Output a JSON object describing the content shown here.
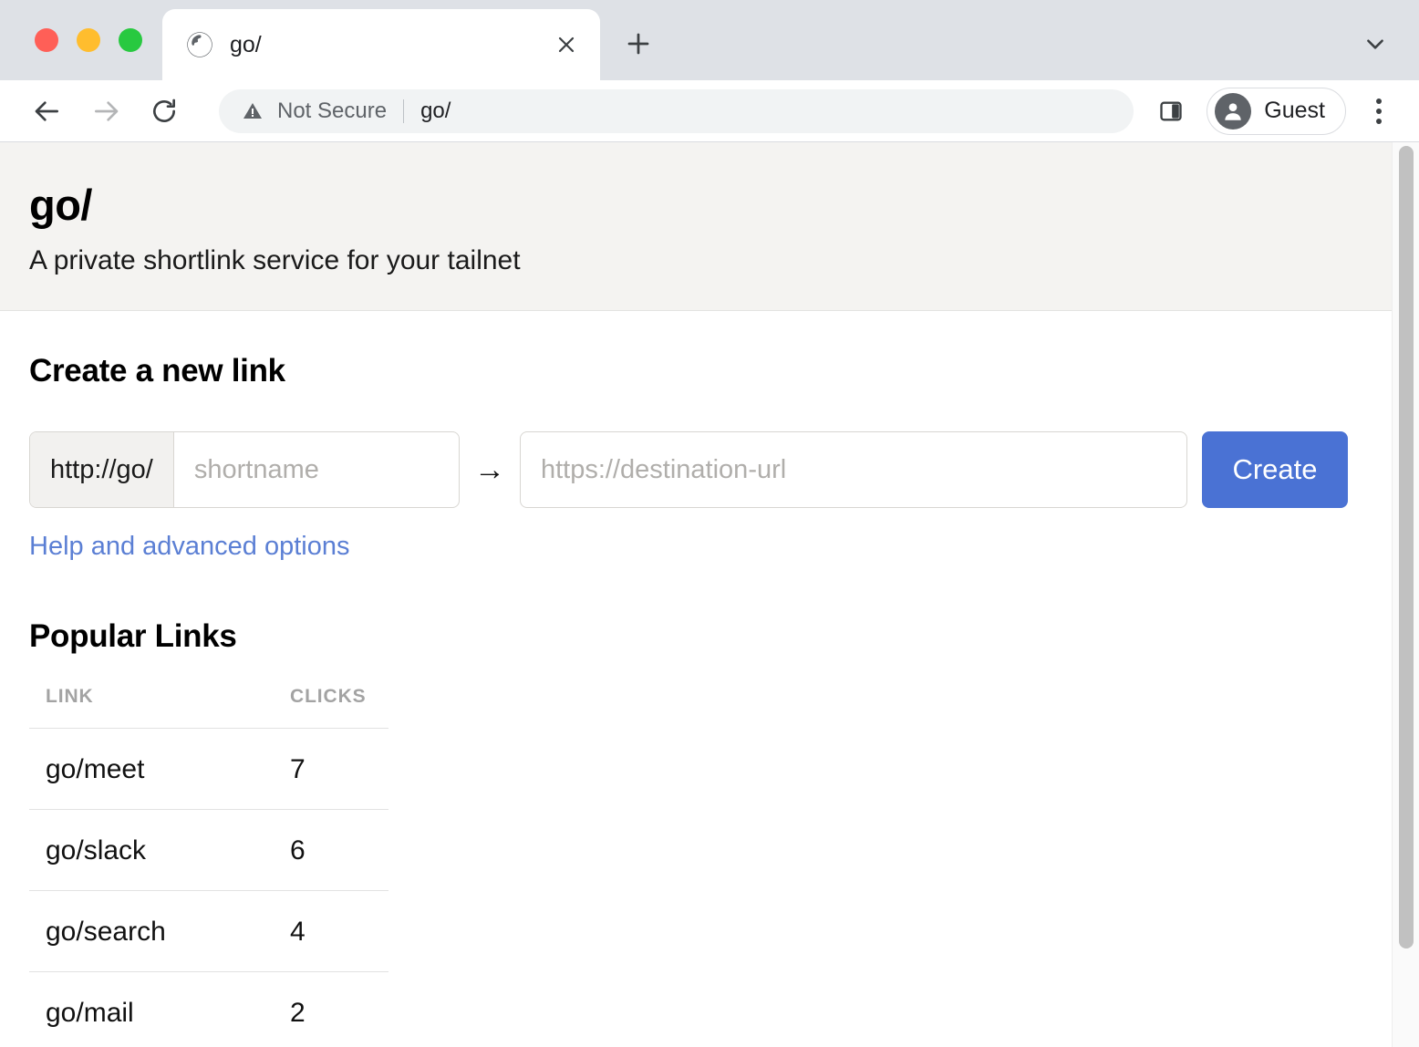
{
  "browser": {
    "window_controls": [
      "close",
      "minimize",
      "zoom"
    ],
    "tab": {
      "title": "go/",
      "favicon": "globe-icon",
      "close_label": "×"
    },
    "new_tab_label": "+",
    "tab_search_icon": "chevron-down-icon",
    "toolbar": {
      "back_icon": "back-arrow-icon",
      "forward_icon": "forward-arrow-icon",
      "reload_icon": "reload-icon",
      "security_icon": "warning-triangle-icon",
      "security_text": "Not Secure",
      "url": "go/",
      "side_panel_icon": "side-panel-icon",
      "profile_name": "Guest",
      "profile_icon": "account-avatar-icon",
      "menu_icon": "kebab-menu-icon"
    }
  },
  "site": {
    "title": "go/",
    "tagline": "A private shortlink service for your tailnet"
  },
  "create": {
    "heading": "Create a new link",
    "prefix": "http://go/",
    "shortname_value": "",
    "shortname_placeholder": "shortname",
    "arrow": "→",
    "destination_value": "",
    "destination_placeholder": "https://destination-url",
    "button_label": "Create",
    "help_link": "Help and advanced options"
  },
  "popular": {
    "heading": "Popular Links",
    "columns": [
      "LINK",
      "CLICKS"
    ],
    "rows": [
      {
        "link": "go/meet",
        "clicks": "7"
      },
      {
        "link": "go/slack",
        "clicks": "6"
      },
      {
        "link": "go/search",
        "clicks": "4"
      },
      {
        "link": "go/mail",
        "clicks": "2"
      }
    ]
  },
  "colors": {
    "accent": "#4a72d4",
    "link": "#5b7fd4",
    "header_band": "#f4f3f1",
    "chrome": "#dee1e6"
  }
}
